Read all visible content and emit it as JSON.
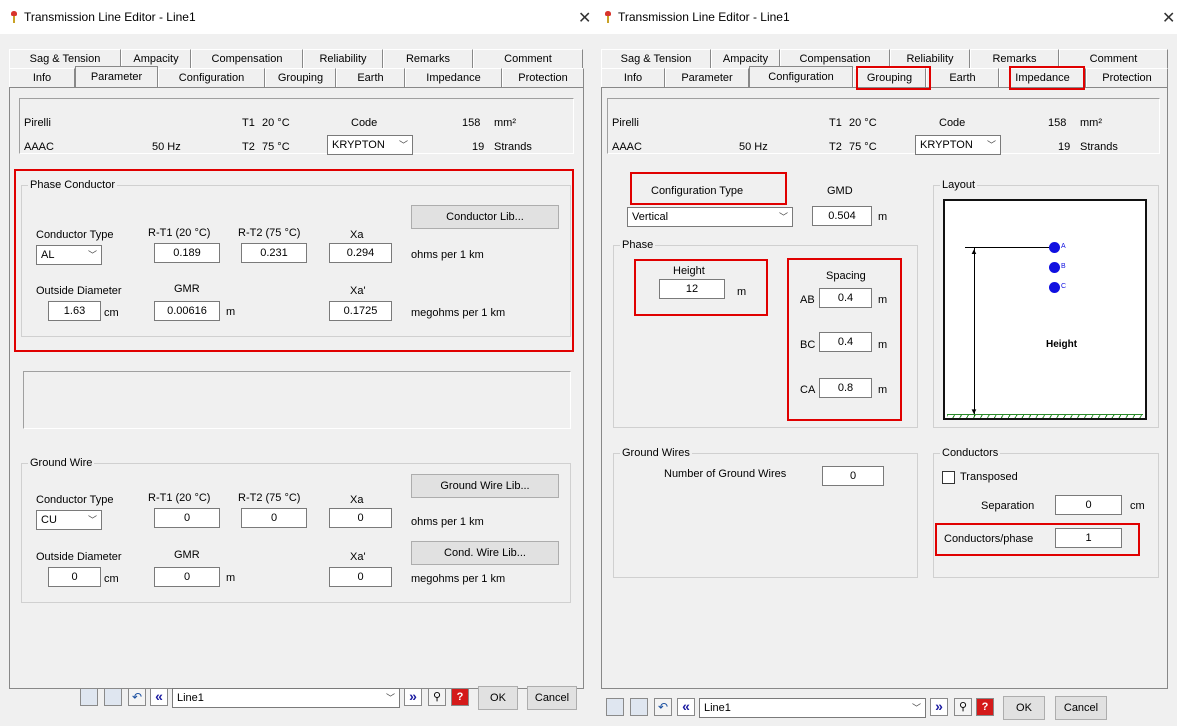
{
  "left": {
    "title": "Transmission Line Editor - Line1",
    "tabs_row1": [
      "Sag & Tension",
      "Ampacity",
      "Compensation",
      "Reliability",
      "Remarks",
      "Comment"
    ],
    "tabs_row2": [
      "Info",
      "Parameter",
      "Configuration",
      "Grouping",
      "Earth",
      "Impedance",
      "Protection"
    ],
    "header": {
      "make": "Pirelli",
      "type": "AAAC",
      "freq": "50 Hz",
      "t1": "T1",
      "t1v": "20 °C",
      "t2": "T2",
      "t2v": "75 °C",
      "code_label": "Code",
      "code": "KRYPTON",
      "area": "158",
      "area_unit": "mm²",
      "strands": "19",
      "strands_label": "Strands"
    },
    "phase": {
      "title": "Phase Conductor",
      "ct_label": "Conductor Type",
      "ct": "AL",
      "rt1_label": "R-T1 (20 °C)",
      "rt1": "0.189",
      "rt2_label": "R-T2 (75 °C)",
      "rt2": "0.231",
      "xa_label": "Xa",
      "xa": "0.294",
      "ohms": "ohms per 1 km",
      "od_label": "Outside Diameter",
      "od": "1.63",
      "cm": "cm",
      "gmr_label": "GMR",
      "gmr": "0.00616",
      "m": "m",
      "xap_label": "Xa'",
      "xap": "0.1725",
      "megohms": "megohms per 1 km",
      "lib": "Conductor Lib..."
    },
    "ground": {
      "title": "Ground Wire",
      "ct_label": "Conductor Type",
      "ct": "CU",
      "rt1_label": "R-T1 (20 °C)",
      "rt1": "0",
      "rt2_label": "R-T2 (75 °C)",
      "rt2": "0",
      "xa_label": "Xa",
      "xa": "0",
      "ohms": "ohms per 1 km",
      "od_label": "Outside Diameter",
      "od": "0",
      "cm": "cm",
      "gmr_label": "GMR",
      "gmr": "0",
      "m": "m",
      "xap_label": "Xa'",
      "xap": "0",
      "megohms": "megohms per 1 km",
      "lib": "Ground Wire Lib...",
      "cond_lib": "Cond. Wire Lib..."
    },
    "footer": {
      "line": "Line1",
      "ok": "OK",
      "cancel": "Cancel"
    }
  },
  "right": {
    "title": "Transmission Line Editor - Line1",
    "tabs_row1": [
      "Sag & Tension",
      "Ampacity",
      "Compensation",
      "Reliability",
      "Remarks",
      "Comment"
    ],
    "tabs_row2": [
      "Info",
      "Parameter",
      "Configuration",
      "Grouping",
      "Earth",
      "Impedance",
      "Protection"
    ],
    "header": {
      "make": "Pirelli",
      "type": "AAAC",
      "freq": "50 Hz",
      "t1": "T1",
      "t1v": "20 °C",
      "t2": "T2",
      "t2v": "75 °C",
      "code_label": "Code",
      "code": "KRYPTON",
      "area": "158",
      "area_unit": "mm²",
      "strands": "19",
      "strands_label": "Strands"
    },
    "config": {
      "type_label": "Configuration Type",
      "type": "Vertical",
      "gmd_label": "GMD",
      "gmd": "0.504",
      "m": "m"
    },
    "phase": {
      "title": "Phase",
      "height_label": "Height",
      "height": "12",
      "m": "m",
      "spacing_label": "Spacing",
      "ab_label": "AB",
      "ab": "0.4",
      "bc_label": "BC",
      "bc": "0.4",
      "ca_label": "CA",
      "ca": "0.8"
    },
    "layout": {
      "title": "Layout",
      "a": "A",
      "b": "B",
      "c": "C",
      "height": "Height"
    },
    "gw": {
      "title": "Ground Wires",
      "n_label": "Number of Ground Wires",
      "n": "0"
    },
    "cond": {
      "title": "Conductors",
      "transposed": "Transposed",
      "sep_label": "Separation",
      "sep": "0",
      "cm": "cm",
      "cpp_label": "Conductors/phase",
      "cpp": "1"
    },
    "footer": {
      "line": "Line1",
      "ok": "OK",
      "cancel": "Cancel"
    }
  },
  "colors": {
    "highlight": "#e00000",
    "phase_dot": "#1010e0"
  }
}
